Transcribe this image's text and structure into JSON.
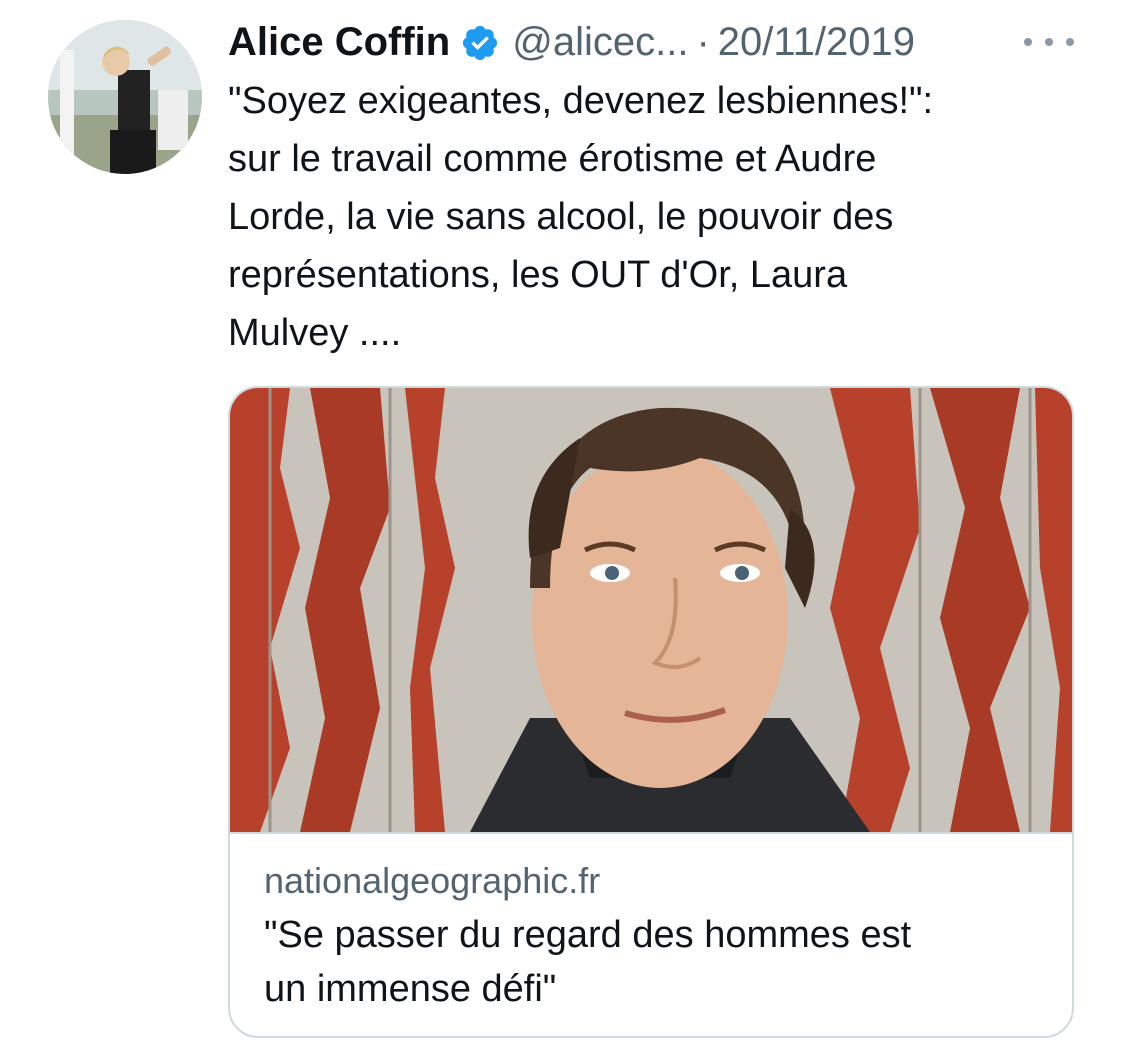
{
  "tweet": {
    "author": {
      "name": "Alice Coffin",
      "handle": "@alicec...",
      "verified": true,
      "avatar_icon": "profile-photo"
    },
    "separator": "·",
    "date": "20/11/2019",
    "more_icon": "more-horizontal-icon",
    "text": "\"Soyez exigeantes, devenez lesbiennes!\":\nsur le travail comme érotisme et Audre\nLorde, la vie sans alcool, le pouvoir des\nreprésentations, les OUT d'Or, Laura\nMulvey ....",
    "link_card": {
      "domain": "nationalgeographic.fr",
      "title": "\"Se passer du regard des hommes est\nun immense défi\""
    }
  },
  "colors": {
    "text_primary": "#0f1419",
    "text_secondary": "#536471",
    "verified_blue": "#1d9bf0",
    "border": "#cfd9de",
    "wall_red": "#b8412b",
    "wall_grey": "#c9c4bb"
  }
}
